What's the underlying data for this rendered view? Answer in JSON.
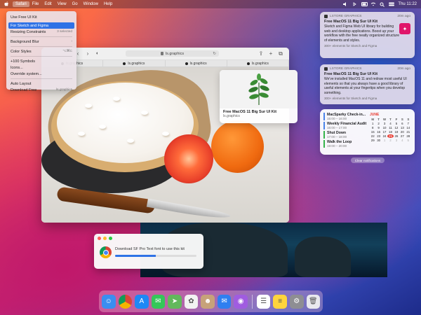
{
  "menubar": {
    "app": "Safari",
    "items": [
      "File",
      "Edit",
      "View",
      "Go",
      "Window",
      "Help"
    ],
    "clock": "Thu 11:22"
  },
  "dropdown": {
    "items": [
      {
        "label": "Use Free UI Kit",
        "shortcut": ""
      },
      {
        "label": "For Sketch and Figma",
        "shortcut": "",
        "highlighted": true
      },
      {
        "label": "Resizing Constraints",
        "shortcut": "3 selected"
      },
      {
        "label": "Background Blur",
        "shortcut": "›"
      },
      {
        "label": "Color Styles",
        "shortcut": "⌥⌘C"
      },
      {
        "label": "+100 Symbols",
        "shortcut": ""
      },
      {
        "label": "Icons...",
        "shortcut": ""
      },
      {
        "label": "Override system...",
        "shortcut": ""
      },
      {
        "label": "Auto Layout",
        "shortcut": ""
      },
      {
        "label": "Download Free",
        "shortcut": "ls.graphics"
      }
    ]
  },
  "browser": {
    "url": "ls.graphics",
    "tabs": [
      "ls.graphics",
      "ls.graphics",
      "ls.graphics",
      "ls.graphics"
    ]
  },
  "preview": {
    "title": "Free MacOS 11 Big Sur UI Kit",
    "url": "ls.graphics"
  },
  "notifications": [
    {
      "app": "LSTORE GRAPHICS",
      "time": "20m ago",
      "title": "Free MacOS 11 Big Sur UI Kit",
      "body": "Sketch and Figma Web UI library for building web and desktop applications. Boost up your workflow with the free neatly organized structure of elements and styles.",
      "foot": "300+ elements for Sketch and Figma"
    },
    {
      "app": "LSTORE GRAPHICS",
      "time": "20m ago",
      "title": "Free MacOS 11 Big Sur UI Kit",
      "body": "We've installed MacOS 11 and redraw most useful UI elements so that you always have a good library of useful elements at your fingertips when you develop something.",
      "foot": "300+ elements for Sketch and Figma"
    }
  ],
  "calendar_widget": {
    "events": [
      {
        "title": "MacSparky Check-in...",
        "time": "15:00 – 16:00",
        "color": "#4a84e8"
      },
      {
        "title": "Weekly Financial Audit",
        "time": "16:00 – 17:00",
        "color": "#4a84e8"
      },
      {
        "title": "Shut Down",
        "time": "17:00 – 18:00",
        "color": "#35b34a"
      },
      {
        "title": "Walk the Loop",
        "time": "19:00 – 20:00",
        "color": "#35b34a"
      }
    ],
    "month": "JUNE",
    "day_headers": [
      "M",
      "T",
      "W",
      "T",
      "F",
      "S",
      "S"
    ],
    "weeks": [
      [
        "1",
        "2",
        "3",
        "4",
        "5",
        "6",
        "7"
      ],
      [
        "8",
        "9",
        "10",
        "11",
        "12",
        "13",
        "14"
      ],
      [
        "15",
        "16",
        "17",
        "18",
        "19",
        "20",
        "21"
      ],
      [
        "22",
        "23",
        "24",
        "25",
        "26",
        "27",
        "28"
      ],
      [
        "29",
        "30",
        "1",
        "2",
        "3",
        "4",
        "5"
      ]
    ],
    "today": "25"
  },
  "clear_label": "Clear notifications",
  "download": {
    "text": "Download SF Pro Text font to use this kit",
    "progress": 0.5
  },
  "dock": {
    "apps": [
      {
        "name": "finder-icon",
        "color": "#3a8ef0",
        "glyph": "☺"
      },
      {
        "name": "chrome-icon",
        "color": "#ffffff",
        "glyph": ""
      },
      {
        "name": "app-store-icon",
        "color": "#1e88f5",
        "glyph": "A"
      },
      {
        "name": "messages-icon",
        "color": "#34c759",
        "glyph": "✉"
      },
      {
        "name": "maps-icon",
        "color": "#62b85c",
        "glyph": "➤"
      },
      {
        "name": "photos-icon",
        "color": "#f2f2f2",
        "glyph": "✿"
      },
      {
        "name": "contacts-icon",
        "color": "#c7a27a",
        "glyph": "☻"
      },
      {
        "name": "mail-icon",
        "color": "#2f7ff0",
        "glyph": "✉"
      },
      {
        "name": "podcasts-icon",
        "color": "#a05ce0",
        "glyph": "◉"
      },
      {
        "name": "reminders-icon",
        "color": "#ffffff",
        "glyph": "☰"
      },
      {
        "name": "notes-icon",
        "color": "#ffd43c",
        "glyph": "≡"
      },
      {
        "name": "system-preferences-icon",
        "color": "#8e8e93",
        "glyph": "⚙"
      },
      {
        "name": "trash-icon",
        "color": "#e9e9ee",
        "glyph": "🗑"
      }
    ]
  }
}
